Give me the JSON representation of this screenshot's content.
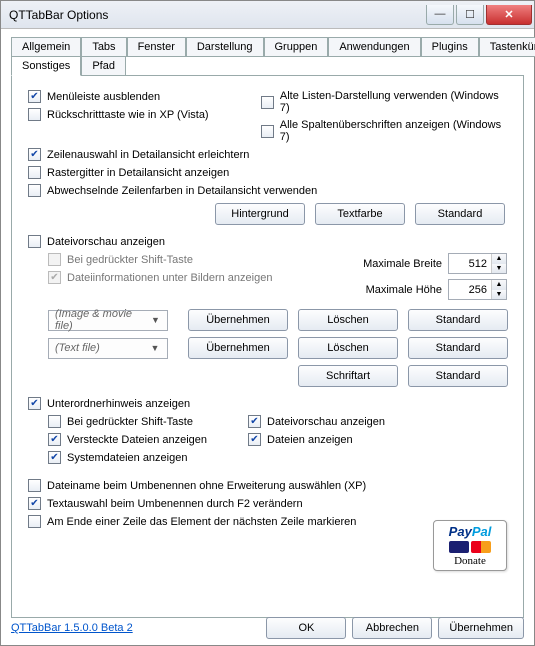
{
  "window": {
    "title": "QTTabBar Options"
  },
  "tabs_row1": [
    "Allgemein",
    "Tabs",
    "Fenster",
    "Darstellung",
    "Gruppen",
    "Anwendungen",
    "Plugins",
    "Tastenkürzel"
  ],
  "tabs_row2": [
    "Sonstiges",
    "Pfad"
  ],
  "active_tab": "Sonstiges",
  "top": {
    "menubar_hide": "Menüleiste ausblenden",
    "old_list": "Alte Listen-Darstellung verwenden (Windows 7)",
    "backspace": "Rückschritttaste wie in XP (Vista)",
    "all_cols": "Alle Spaltenüberschriften anzeigen (Windows 7)",
    "row_select": "Zeilenauswahl in Detailansicht erleichtern",
    "grid_detail": "Rastergitter in Detailansicht anzeigen",
    "alt_rows": "Abwechselnde Zeilenfarben in Detailansicht verwenden"
  },
  "btns_colors": {
    "bg": "Hintergrund",
    "fg": "Textfarbe",
    "def": "Standard"
  },
  "preview": {
    "header": "Dateivorschau anzeigen",
    "shift": "Bei gedrückter Shift-Taste",
    "info_under": "Dateiinformationen unter Bildern anzeigen",
    "max_w": "Maximale Breite",
    "max_h": "Maximale Höhe",
    "w": "512",
    "h": "256",
    "combo_img": "(Image & movie file)",
    "combo_txt": "(Text file)",
    "apply": "Übernehmen",
    "del": "Löschen",
    "def": "Standard",
    "font": "Schriftart"
  },
  "subfolder": {
    "header": "Unterordnerhinweis anzeigen",
    "shift": "Bei gedrückter Shift-Taste",
    "preview": "Dateivorschau anzeigen",
    "hidden": "Versteckte Dateien anzeigen",
    "files": "Dateien anzeigen",
    "system": "Systemdateien anzeigen"
  },
  "bottom": {
    "noext": "Dateiname beim Umbenennen ohne Erweiterung auswählen (XP)",
    "f2": "Textauswahl beim Umbenennen durch F2 verändern",
    "wrap": "Am Ende einer Zeile das Element der nächsten Zeile markieren"
  },
  "donate": {
    "paypal_a": "Pay",
    "paypal_b": "Pal",
    "donate": "Donate"
  },
  "footer": {
    "version": "QTTabBar 1.5.0.0 Beta 2",
    "ok": "OK",
    "cancel": "Abbrechen",
    "apply": "Übernehmen"
  }
}
